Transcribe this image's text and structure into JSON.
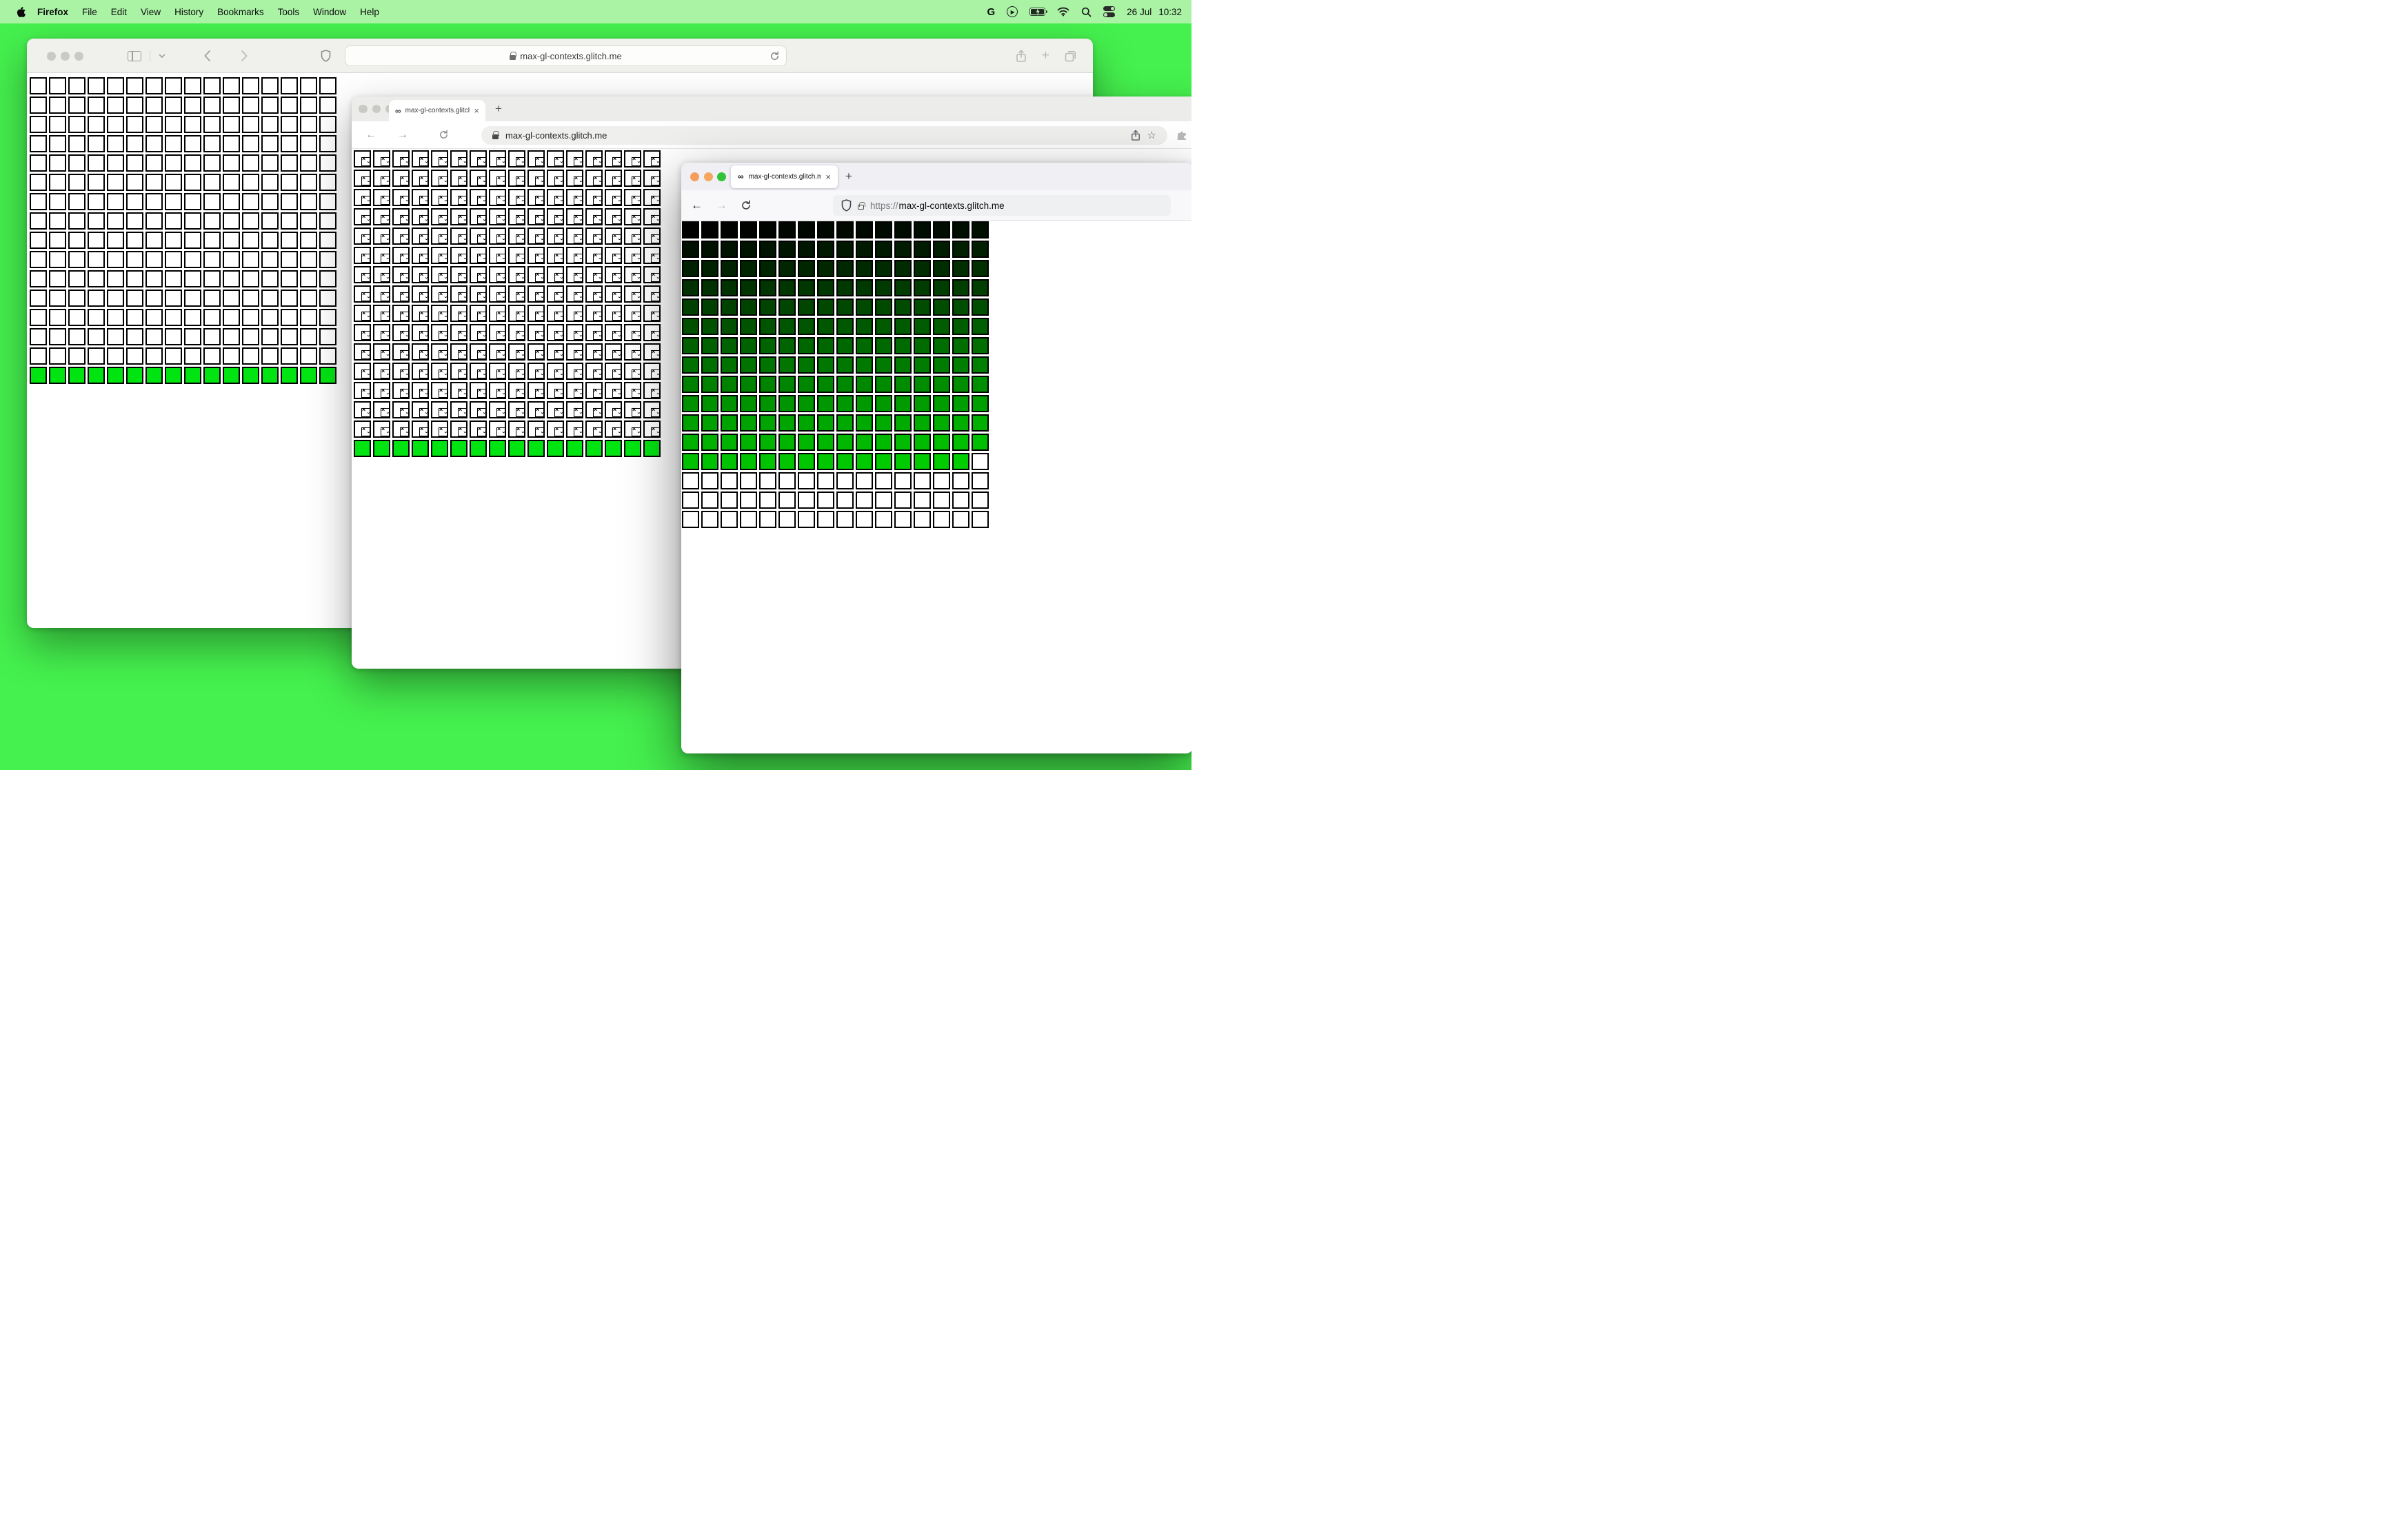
{
  "colors": {
    "desktop": "#45f14e",
    "menubar": "#aaf3a5",
    "cell_green": "#00e512",
    "tl_inactive": "#c9c9c6",
    "tl_close": "#f59d5c",
    "tl_min": "#f6a75f",
    "tl_zoom": "#33c23a"
  },
  "menu_bar": {
    "app": "Firefox",
    "menus": [
      "File",
      "Edit",
      "View",
      "History",
      "Bookmarks",
      "Tools",
      "Window",
      "Help"
    ],
    "status_icons": [
      "google-icon",
      "play-circle-icon",
      "battery-charging-icon",
      "wifi-icon",
      "search-icon",
      "control-center-icon"
    ],
    "google_glyph": "G",
    "date": "26 Jul",
    "time": "10:32"
  },
  "glyphs": {
    "infinity": "∞",
    "close": "×",
    "plus": "+",
    "star": "☆",
    "back": "←",
    "forward": "→",
    "play": "▶",
    "broken_x": "×",
    "broken_wave": "ˇ"
  },
  "safari_window": {
    "url": "max-gl-contexts.glitch.me",
    "grid": {
      "cols": 16,
      "rows": 16,
      "plain_white_cells": 240,
      "green_cells": 16
    }
  },
  "chrome_window": {
    "tab_title": "max-gl-contexts.glitch.me",
    "url": "max-gl-contexts.glitch.me",
    "grid": {
      "cols": 16,
      "rows": 16,
      "broken_image_cells": 240,
      "green_cells": 16
    }
  },
  "firefox_window": {
    "tab_title": "max-gl-contexts.glitch.me/",
    "url_scheme": "https://",
    "url_host": "max-gl-contexts.glitch.me",
    "grid": {
      "cols": 16,
      "rows": 16,
      "gradient_cells": 207,
      "total_cells": 256,
      "gradient_formula": "rgb(0, index, 0)",
      "empty_color": "#ffffff"
    }
  }
}
